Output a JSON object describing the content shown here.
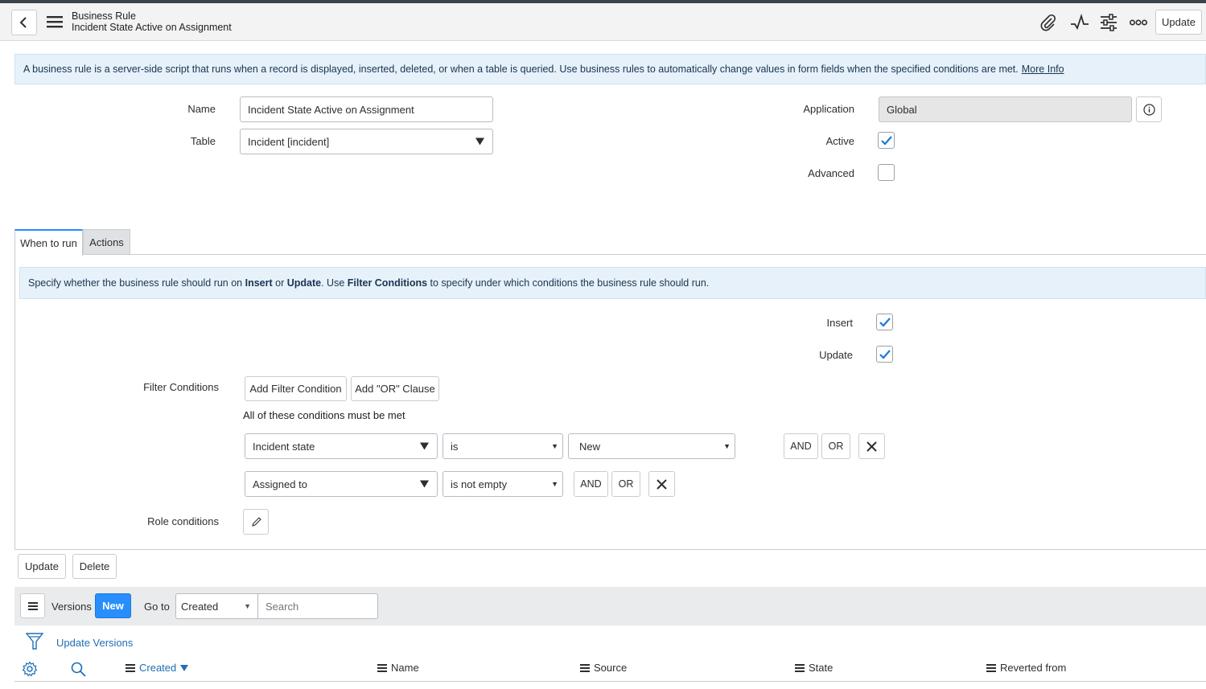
{
  "header": {
    "title": "Business Rule",
    "subtitle": "Incident State Active on Assignment",
    "update_label": "Update"
  },
  "info": {
    "text": "A business rule is a server-side script that runs when a record is displayed, inserted, deleted, or when a table is queried. Use business rules to automatically change values in form fields when the specified conditions are met.",
    "more_info": "More Info"
  },
  "form": {
    "name_label": "Name",
    "name_value": "Incident State Active on Assignment",
    "table_label": "Table",
    "table_value": "Incident [incident]",
    "application_label": "Application",
    "application_value": "Global",
    "active_label": "Active",
    "active_checked": true,
    "advanced_label": "Advanced",
    "advanced_checked": false
  },
  "tabs": [
    {
      "label": "When to run",
      "selected": true
    },
    {
      "label": "Actions",
      "selected": false
    }
  ],
  "when": {
    "info_parts": [
      "Specify whether the business rule should run on ",
      "Insert",
      " or ",
      "Update",
      ". Use ",
      "Filter Conditions",
      " to specify under which conditions the business rule should run."
    ],
    "insert_label": "Insert",
    "insert_checked": true,
    "update_label": "Update",
    "update_checked": true,
    "filter_label": "Filter Conditions",
    "add_filter_label": "Add Filter Condition",
    "add_or_label": "Add \"OR\" Clause",
    "all_conditions_text": "All of these conditions must be met",
    "conditions": [
      {
        "field": "Incident state",
        "operator": "is",
        "value": "New",
        "and": "AND",
        "or": "OR"
      },
      {
        "field": "Assigned to",
        "operator": "is not empty",
        "value": "",
        "and": "AND",
        "or": "OR"
      }
    ],
    "role_label": "Role conditions"
  },
  "actions": {
    "update_label": "Update",
    "delete_label": "Delete"
  },
  "related": {
    "versions_label": "Versions",
    "new_label": "New",
    "goto_label": "Go to",
    "goto_value": "Created",
    "search_placeholder": "Search",
    "breadcrumb": "Update Versions",
    "columns": [
      "Created",
      "Name",
      "Source",
      "State",
      "Reverted from"
    ]
  },
  "colors": {
    "accent": "#278efc",
    "link": "#1f6fb3",
    "checkbox_check": "#1a7ad4",
    "info_bg": "#e6f1fa"
  }
}
